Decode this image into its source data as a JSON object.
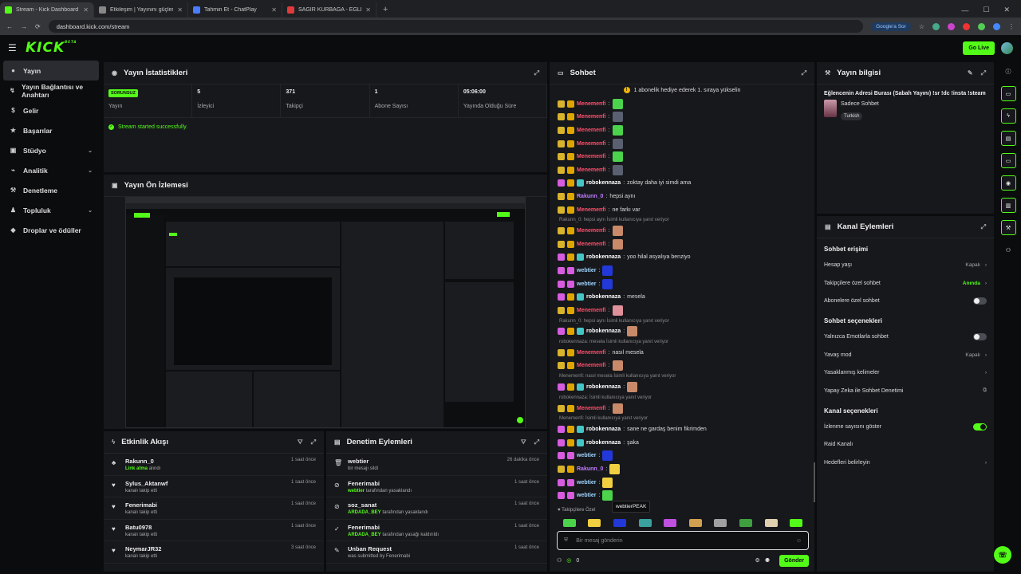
{
  "browser": {
    "tabs": [
      {
        "title": "Stream - Kick Dashboard",
        "color": "#53fc18",
        "active": true
      },
      {
        "title": "Etkileşim | Yayınını güçlendir",
        "color": "#888888",
        "active": false
      },
      {
        "title": "Tahmin Et - ChatPlay",
        "color": "#4a7cff",
        "active": false
      },
      {
        "title": "SAĞIR KURBAĞA - EĞLENCELİ",
        "color": "#e03a3a",
        "active": false
      }
    ],
    "url": "dashboard.kick.com/stream",
    "google_sor": "Google'a Sor"
  },
  "topbar": {
    "logo": "KICK",
    "beta": "BETA",
    "go_live": "Go Live"
  },
  "sidebar": {
    "items": [
      {
        "label": "Yayın",
        "icon": "●",
        "active": true,
        "chev": ""
      },
      {
        "label": "Yayın Bağlantısı ve Anahtarı",
        "icon": "↯",
        "active": false,
        "chev": ""
      },
      {
        "label": "Gelir",
        "icon": "$",
        "active": false,
        "chev": ""
      },
      {
        "label": "Başarılar",
        "icon": "★",
        "active": false,
        "chev": ""
      },
      {
        "label": "Stüdyo",
        "icon": "▣",
        "active": false,
        "chev": "⌄"
      },
      {
        "label": "Analitik",
        "icon": "⌁",
        "active": false,
        "chev": "⌄"
      },
      {
        "label": "Denetleme",
        "icon": "⚒",
        "active": false,
        "chev": ""
      },
      {
        "label": "Topluluk",
        "icon": "♟",
        "active": false,
        "chev": "⌄"
      },
      {
        "label": "Droplar ve ödüller",
        "icon": "◆",
        "active": false,
        "chev": ""
      }
    ]
  },
  "stats_panel": {
    "title": "Yayın İstatistikleri",
    "status_badge": "SORUNSUZ",
    "stats": [
      {
        "value": "",
        "label": "Yayın"
      },
      {
        "value": "5",
        "label": "İzleyici"
      },
      {
        "value": "371",
        "label": "Takipçi"
      },
      {
        "value": "1",
        "label": "Abone Sayısı"
      },
      {
        "value": "05:06:00",
        "label": "Yayında Olduğu Süre"
      }
    ],
    "started_msg": "Stream started successfully."
  },
  "preview_panel": {
    "title": "Yayın Ön İzlemesi"
  },
  "activity_panel": {
    "title": "Etkinlik Akışı",
    "rows": [
      {
        "icon": "♣",
        "name": "Rakunn_0",
        "sub_hl": "Link atma",
        "sub": "alındı",
        "time": "1 saat önce"
      },
      {
        "icon": "♥",
        "name": "Sylus_Aktanwf",
        "sub_hl": "",
        "sub": "kanalı takip etti",
        "time": "1 saat önce"
      },
      {
        "icon": "♥",
        "name": "Fenerimabi",
        "sub_hl": "",
        "sub": "kanalı takip etti",
        "time": "1 saat önce"
      },
      {
        "icon": "♥",
        "name": "Batu0978",
        "sub_hl": "",
        "sub": "kanalı takip etti",
        "time": "1 saat önce"
      },
      {
        "icon": "♥",
        "name": "NeymarJR32",
        "sub_hl": "",
        "sub": "kanalı takip etti",
        "time": "3 saat önce"
      }
    ]
  },
  "moderation_panel": {
    "title": "Denetim Eylemleri",
    "rows": [
      {
        "icon": "🗑",
        "name": "webtier",
        "sub_hl": "",
        "sub": "bir mesajı sildi",
        "time": "26 dakika önce"
      },
      {
        "icon": "⊘",
        "name": "Fenerimabi",
        "sub_hl": "webtier",
        "sub": "tarafından yasaklandı",
        "time": "1 saat önce"
      },
      {
        "icon": "⊘",
        "name": "soz_sanat",
        "sub_hl": "ARDADA_BEY",
        "sub": "tarafından yasaklandı",
        "time": "1 saat önce"
      },
      {
        "icon": "✓",
        "name": "Fenerimabi",
        "sub_hl": "ARDADA_BEY",
        "sub": "tarafından yasağı kaldırıldı",
        "time": "1 saat önce"
      },
      {
        "icon": "✎",
        "name": "Unban Request",
        "sub_hl": "",
        "sub": "was submitted by Fenerimabi",
        "time": "1 saat önce"
      }
    ]
  },
  "chat_panel": {
    "title": "Sohbet",
    "pinned": "1 abonelik hediye ederek 1. sıraya yükselin",
    "pinned_icon": "!",
    "messages": [
      {
        "kind": "msg",
        "badges": [
          "y",
          "c"
        ],
        "user": "Menemenfi",
        "color": "#ff4f6b",
        "text": "",
        "emote": "#4bd44b"
      },
      {
        "kind": "msg",
        "badges": [
          "y",
          "c"
        ],
        "user": "Menemenfi",
        "color": "#ff4f6b",
        "text": "",
        "emote": "#5a6070"
      },
      {
        "kind": "msg",
        "badges": [
          "y",
          "c"
        ],
        "user": "Menemenfi",
        "color": "#ff4f6b",
        "text": "",
        "emote": "#4bd44b"
      },
      {
        "kind": "msg",
        "badges": [
          "y",
          "c"
        ],
        "user": "Menemenfi",
        "color": "#ff4f6b",
        "text": "",
        "emote": "#5a6070"
      },
      {
        "kind": "msg",
        "badges": [
          "y",
          "c"
        ],
        "user": "Menemenfi",
        "color": "#ff4f6b",
        "text": "",
        "emote": "#4bd44b"
      },
      {
        "kind": "msg",
        "badges": [
          "y",
          "c"
        ],
        "user": "Menemenfi",
        "color": "#ff4f6b",
        "text": "",
        "emote": "#5a6070"
      },
      {
        "kind": "msg",
        "badges": [
          "p",
          "c",
          "t"
        ],
        "user": "robokennaza",
        "color": "#ffffff",
        "text": "zoktay daha iyi simdi ama",
        "emote": ""
      },
      {
        "kind": "msg",
        "badges": [
          "y",
          "c"
        ],
        "user": "Rakunn_0",
        "color": "#c07cff",
        "text": "hepsi aynı",
        "emote": ""
      },
      {
        "kind": "msg",
        "badges": [
          "y",
          "c"
        ],
        "user": "Menemenfi",
        "color": "#ff4f6b",
        "text": "ne farkı var",
        "emote": ""
      },
      {
        "kind": "reply",
        "text": "Rakunn_0: hepsi aynı İsimli kullanıcıya yanıt veriyor"
      },
      {
        "kind": "msg",
        "badges": [
          "y",
          "c"
        ],
        "user": "Menemenfi",
        "color": "#ff4f6b",
        "text": "",
        "emote": "#c98a6a"
      },
      {
        "kind": "msg",
        "badges": [
          "y",
          "c"
        ],
        "user": "Menemenfi",
        "color": "#ff4f6b",
        "text": "",
        "emote": "#c98a6a"
      },
      {
        "kind": "msg",
        "badges": [
          "p",
          "c",
          "t"
        ],
        "user": "robokennaza",
        "color": "#ffffff",
        "text": "yoo hilal asyalıya benziyo",
        "emote": ""
      },
      {
        "kind": "msg",
        "badges": [
          "p",
          "p"
        ],
        "user": "webtier",
        "color": "#9fd6ff",
        "text": "",
        "emote": "#2238d8"
      },
      {
        "kind": "msg",
        "badges": [
          "p",
          "p"
        ],
        "user": "webtier",
        "color": "#9fd6ff",
        "text": "",
        "emote": "#2238d8"
      },
      {
        "kind": "msg",
        "badges": [
          "p",
          "c",
          "t"
        ],
        "user": "robokennaza",
        "color": "#ffffff",
        "text": "mesela",
        "emote": ""
      },
      {
        "kind": "msg",
        "badges": [
          "y",
          "c"
        ],
        "user": "Menemenfi",
        "color": "#ff4f6b",
        "text": "",
        "emote": "#e0909a"
      },
      {
        "kind": "reply",
        "text": "Rakunn_0: hepsi aynı İsimli kullanıcıya yanıt veriyor"
      },
      {
        "kind": "msg",
        "badges": [
          "p",
          "c",
          "t"
        ],
        "user": "robokennaza",
        "color": "#ffffff",
        "text": "",
        "emote": "#c98a6a"
      },
      {
        "kind": "reply",
        "text": "robokennaza: mesela İsimli kullanıcıya yanıt veriyor"
      },
      {
        "kind": "msg",
        "badges": [
          "y",
          "c"
        ],
        "user": "Menemenfi",
        "color": "#ff4f6b",
        "text": "nasıl mesela",
        "emote": ""
      },
      {
        "kind": "msg",
        "badges": [
          "y",
          "c"
        ],
        "user": "Menemenfi",
        "color": "#ff4f6b",
        "text": "",
        "emote": "#c98a6a"
      },
      {
        "kind": "reply",
        "text": "Menemenfi: nasıl mesela İsimli kullanıcıya yanıt veriyor"
      },
      {
        "kind": "msg",
        "badges": [
          "p",
          "c",
          "t"
        ],
        "user": "robokennaza",
        "color": "#ffffff",
        "text": "",
        "emote": "#c98a6a"
      },
      {
        "kind": "reply",
        "text": "robokennaza: İsimli kullanıcıya yanıt veriyor"
      },
      {
        "kind": "msg",
        "badges": [
          "y",
          "c"
        ],
        "user": "Menemenfi",
        "color": "#ff4f6b",
        "text": "",
        "emote": "#c98a6a"
      },
      {
        "kind": "reply",
        "text": "Menemenfi: İsimli kullanıcıya yanıt veriyor"
      },
      {
        "kind": "msg",
        "badges": [
          "p",
          "c",
          "t"
        ],
        "user": "robokennaza",
        "color": "#ffffff",
        "text": "sane ne gardaş benim fikrimden",
        "emote": ""
      },
      {
        "kind": "msg",
        "badges": [
          "p",
          "c",
          "t"
        ],
        "user": "robokennaza",
        "color": "#ffffff",
        "text": "şaka",
        "emote": ""
      },
      {
        "kind": "msg",
        "badges": [
          "p",
          "p"
        ],
        "user": "webtier",
        "color": "#9fd6ff",
        "text": "",
        "emote": "#2238d8"
      },
      {
        "kind": "msg",
        "badges": [
          "y",
          "c"
        ],
        "user": "Rakunn_0",
        "color": "#c07cff",
        "text": "",
        "emote": "#f0d040"
      },
      {
        "kind": "msg",
        "badges": [
          "p",
          "p"
        ],
        "user": "webtier",
        "color": "#9fd6ff",
        "text": "",
        "emote": "#f0d040"
      },
      {
        "kind": "msg",
        "badges": [
          "p",
          "p"
        ],
        "user": "webtier",
        "color": "#9fd6ff",
        "text": "",
        "emote": "#4bd44b"
      }
    ],
    "followers_only": "Takipçilere Özel",
    "tooltip": "webtierPEAK",
    "emotes": [
      "#4bd44b",
      "#f0d040",
      "#2238d8",
      "#3aa0a0",
      "#c050e0",
      "#d0a050",
      "#a0a0a0",
      "#40a040",
      "#e0d0b0",
      "#53fc18"
    ],
    "input_placeholder": "Bir mesaj gönderin",
    "points": "0",
    "send_label": "Gönder"
  },
  "info_panel": {
    "title": "Yayın bilgisi",
    "stream_title": "Eğlencenin Adresi Burası (Sabah Yayını) !sr !dc !insta !steam",
    "category": "Sadece Sohbet",
    "tag": "Turkish"
  },
  "channel_panel": {
    "title": "Kanal Eylemleri",
    "sections": [
      {
        "heading": "Sohbet erişimi",
        "options": [
          {
            "label": "Hesap yaşı",
            "value": "Kapalı",
            "value_green": false,
            "control": "chev"
          },
          {
            "label": "Takipçilere özel sohbet",
            "value": "Anında",
            "value_green": true,
            "control": "chev"
          },
          {
            "label": "Abonelere özel sohbet",
            "value": "",
            "value_green": false,
            "control": "off"
          }
        ]
      },
      {
        "heading": "Sohbet seçenekleri",
        "options": [
          {
            "label": "Yalnızca Emotlarla sohbet",
            "value": "",
            "value_green": false,
            "control": "off"
          },
          {
            "label": "Yavaş mod",
            "value": "Kapalı",
            "value_green": false,
            "control": "chev"
          },
          {
            "label": "Yasaklanmış kelimeler",
            "value": "",
            "value_green": false,
            "control": "chev"
          },
          {
            "label": "Yapay Zeka ile Sohbet Denetimi",
            "value": "",
            "value_green": false,
            "control": "ext"
          }
        ]
      },
      {
        "heading": "Kanal seçenekleri",
        "options": [
          {
            "label": "İzlenme sayısını göster",
            "value": "",
            "value_green": false,
            "control": "on"
          },
          {
            "label": "Raid Kanalı",
            "value": "",
            "value_green": false,
            "control": "none"
          },
          {
            "label": "Hedefleri belirleyin",
            "value": "",
            "value_green": false,
            "control": "chev"
          }
        ]
      }
    ]
  },
  "rail_icons": [
    "info-icon",
    "chat-icon",
    "bolt-icon",
    "doc-icon",
    "message-icon",
    "radio-icon",
    "archive-icon",
    "wrench-icon",
    "users-icon"
  ]
}
